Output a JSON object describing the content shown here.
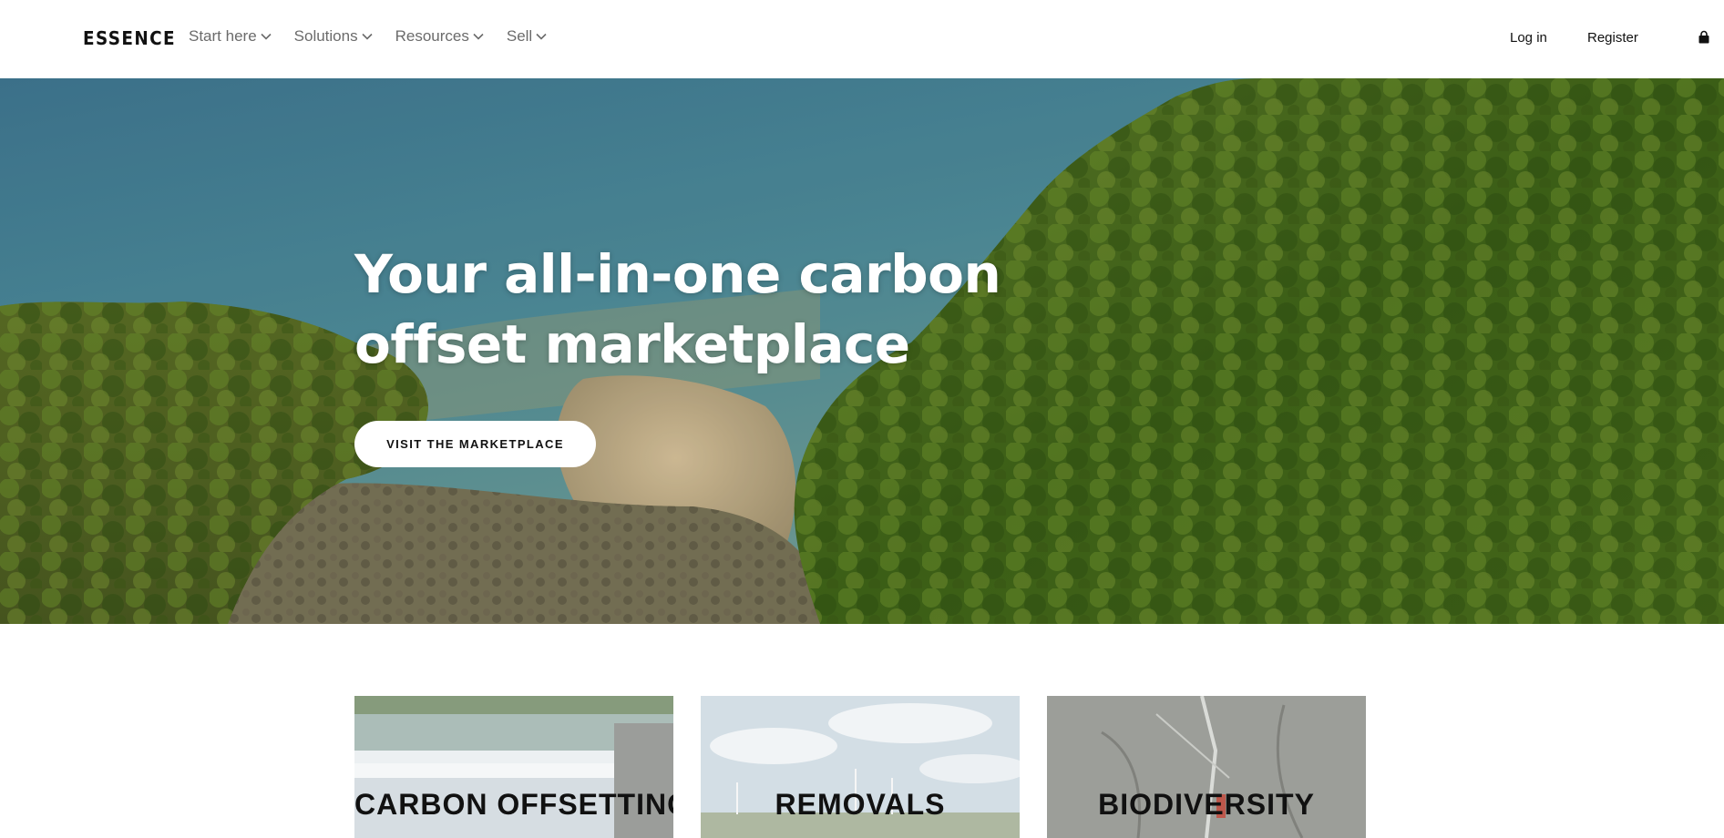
{
  "header": {
    "logo": "ESSENCE",
    "nav": [
      {
        "label": "Start here"
      },
      {
        "label": "Solutions"
      },
      {
        "label": "Resources"
      },
      {
        "label": "Sell"
      }
    ],
    "login_label": "Log in",
    "register_label": "Register",
    "cart_icon": "shopping-bag-icon"
  },
  "hero": {
    "title": "Your all-in-one carbon offset marketplace",
    "button_label": "VISIT THE MARKETPLACE",
    "image": "aerial-forest-coast"
  },
  "categories": [
    {
      "label": "CARBON OFFSETTING",
      "image": "waterfall-weir"
    },
    {
      "label": "REMOVALS",
      "image": "wind-farm-field"
    },
    {
      "label": "BIODIVERSITY",
      "image": "branches-undergrowth"
    }
  ],
  "colors": {
    "nav_text": "#6b6b6b",
    "hero_text": "#ffffff",
    "button_bg": "#ffffff"
  }
}
